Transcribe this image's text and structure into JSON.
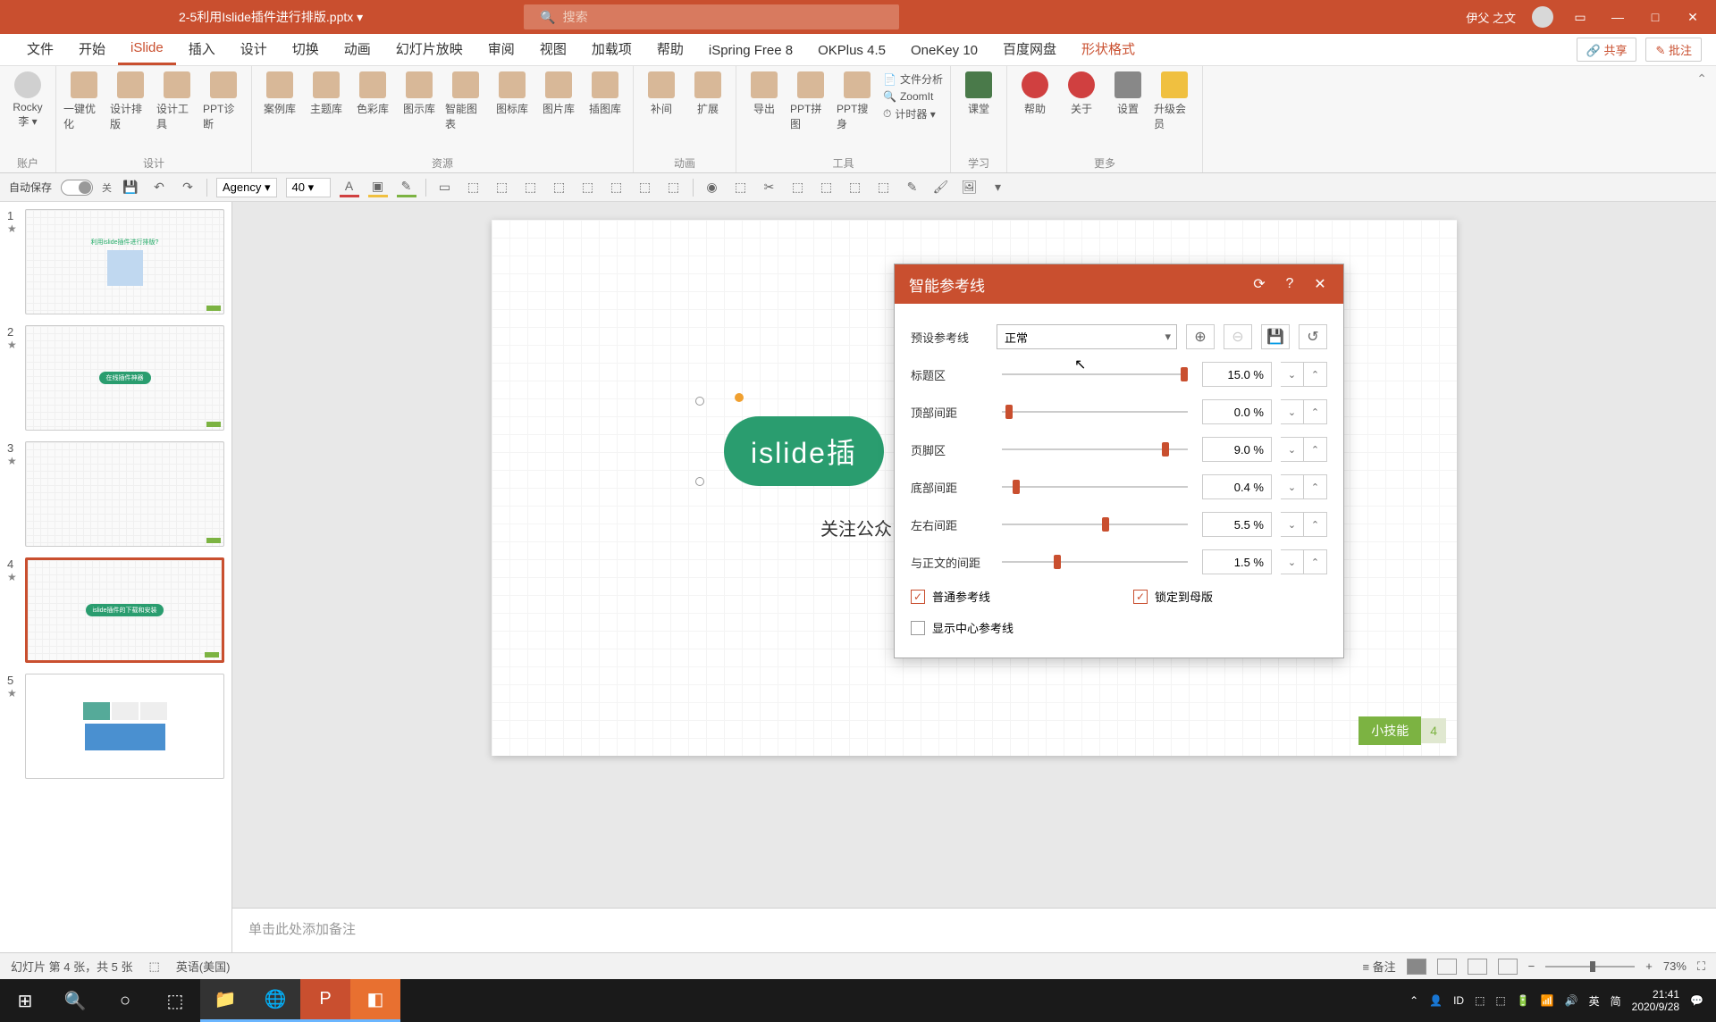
{
  "titlebar": {
    "filename": "2-5利用Islide插件进行排版.pptx ▾",
    "search_placeholder": "搜索",
    "username": "伊父 之文"
  },
  "tabs": {
    "items": [
      "文件",
      "开始",
      "iSlide",
      "插入",
      "设计",
      "切换",
      "动画",
      "幻灯片放映",
      "审阅",
      "视图",
      "加载项",
      "帮助",
      "iSpring Free 8",
      "OKPlus 4.5",
      "OneKey 10",
      "百度网盘",
      "形状格式"
    ],
    "active_index": 2,
    "share": "共享",
    "comment": "批注"
  },
  "ribbon": {
    "account": {
      "label": "账户",
      "items": [
        {
          "label": "Rocky\n李 ▾"
        }
      ]
    },
    "design": {
      "label": "设计",
      "items": [
        {
          "label": "一键优化"
        },
        {
          "label": "设计排版"
        },
        {
          "label": "设计工具"
        },
        {
          "label": "PPT诊断"
        }
      ]
    },
    "resource": {
      "label": "资源",
      "items": [
        {
          "label": "案例库"
        },
        {
          "label": "主题库"
        },
        {
          "label": "色彩库"
        },
        {
          "label": "图示库"
        },
        {
          "label": "智能图表"
        },
        {
          "label": "图标库"
        },
        {
          "label": "图片库"
        },
        {
          "label": "插图库"
        }
      ]
    },
    "anim": {
      "label": "动画",
      "items": [
        {
          "label": "补间"
        },
        {
          "label": "扩展"
        }
      ]
    },
    "tool": {
      "label": "工具",
      "items": [
        {
          "label": "导出"
        },
        {
          "label": "PPT拼图"
        },
        {
          "label": "PPT搜身"
        }
      ],
      "side": [
        {
          "label": "文件分析"
        },
        {
          "label": "ZoomIt"
        },
        {
          "label": "计时器 ▾"
        }
      ]
    },
    "learn": {
      "label": "学习",
      "items": [
        {
          "label": "课堂"
        }
      ]
    },
    "more": {
      "label": "更多",
      "items": [
        {
          "label": "帮助"
        },
        {
          "label": "关于"
        },
        {
          "label": "设置"
        },
        {
          "label": "升级会员"
        }
      ]
    }
  },
  "qat": {
    "autosave": "自动保存",
    "autosave_off": "关",
    "font_name": "Agency",
    "font_size": "40"
  },
  "thumbs": [
    {
      "idx": "1",
      "pill": false,
      "selected": false
    },
    {
      "idx": "2",
      "pill": "在线插件神器",
      "selected": false
    },
    {
      "idx": "3",
      "pill": false,
      "selected": false
    },
    {
      "idx": "4",
      "pill": "islide插件的下载和安装",
      "selected": true
    },
    {
      "idx": "5",
      "pill": false,
      "selected": false
    }
  ],
  "slide": {
    "title": "islide插",
    "subtitle": "关注公众",
    "badge_label": "小技能",
    "badge_num": "4"
  },
  "dialog": {
    "title": "智能参考线",
    "preset_label": "预设参考线",
    "preset_value": "正常",
    "rows": [
      {
        "label": "标题区",
        "value": "15.0 %",
        "pos": 96
      },
      {
        "label": "顶部间距",
        "value": "0.0 %",
        "pos": 2
      },
      {
        "label": "页脚区",
        "value": "9.0 %",
        "pos": 86
      },
      {
        "label": "底部间距",
        "value": "0.4 %",
        "pos": 6
      },
      {
        "label": "左右间距",
        "value": "5.5 %",
        "pos": 54
      },
      {
        "label": "与正文的间距",
        "value": "1.5 %",
        "pos": 28
      }
    ],
    "chk_normal": "普通参考线",
    "chk_lock": "锁定到母版",
    "chk_center": "显示中心参考线"
  },
  "notes": {
    "placeholder": "单击此处添加备注"
  },
  "statusbar": {
    "slide_info": "幻灯片 第 4 张，共 5 张",
    "lang": "英语(美国)",
    "notes_btn": "备注",
    "zoom": "73%"
  },
  "taskbar": {
    "time": "21:41",
    "date": "2020/9/28",
    "ime": "英",
    "ime2": "简"
  }
}
